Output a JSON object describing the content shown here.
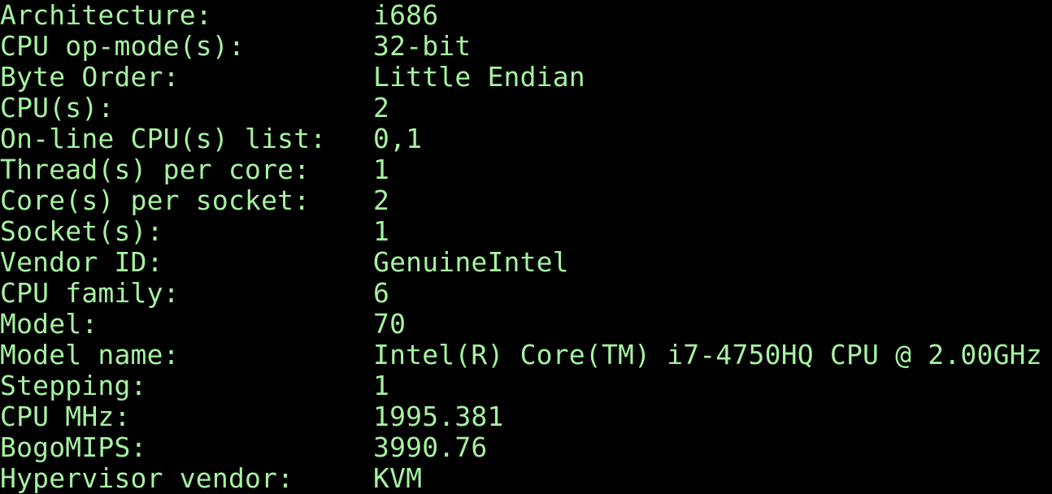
{
  "theme": {
    "background": "#000000",
    "text": "#a6f1a0"
  },
  "lscpu": [
    {
      "label": "Architecture:",
      "value": "i686"
    },
    {
      "label": "CPU op-mode(s):",
      "value": "32-bit"
    },
    {
      "label": "Byte Order:",
      "value": "Little Endian"
    },
    {
      "label": "CPU(s):",
      "value": "2"
    },
    {
      "label": "On-line CPU(s) list:",
      "value": "0,1"
    },
    {
      "label": "Thread(s) per core:",
      "value": "1"
    },
    {
      "label": "Core(s) per socket:",
      "value": "2"
    },
    {
      "label": "Socket(s):",
      "value": "1"
    },
    {
      "label": "Vendor ID:",
      "value": "GenuineIntel"
    },
    {
      "label": "CPU family:",
      "value": "6"
    },
    {
      "label": "Model:",
      "value": "70"
    },
    {
      "label": "Model name:",
      "value": "Intel(R) Core(TM) i7-4750HQ CPU @ 2.00GHz"
    },
    {
      "label": "Stepping:",
      "value": "1"
    },
    {
      "label": "CPU MHz:",
      "value": "1995.381"
    },
    {
      "label": "BogoMIPS:",
      "value": "3990.76"
    },
    {
      "label": "Hypervisor vendor:",
      "value": "KVM"
    }
  ]
}
